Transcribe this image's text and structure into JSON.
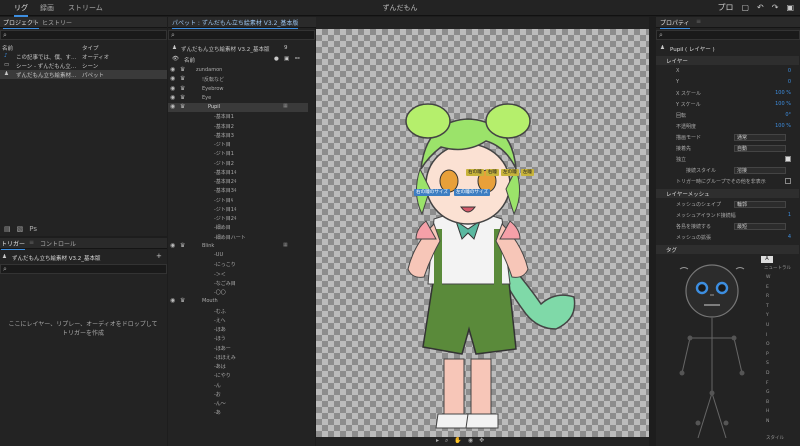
{
  "app": {
    "window_title": "ずんだもん",
    "tabs": [
      "リグ",
      "録画",
      "ストリーム"
    ],
    "user_label": "プロ"
  },
  "project_panel": {
    "tabs": [
      "プロジェクト",
      "ヒストリー"
    ],
    "col_name": "名前",
    "col_type": "タイプ",
    "items": [
      {
        "name": "この記事では、僕、す…",
        "type": "オーディオ"
      },
      {
        "name": "シーン - ずんだもん立…",
        "type": "シーン"
      },
      {
        "name": "ずんだもん立ち絵素材…",
        "type": "パペット"
      }
    ]
  },
  "trigger_panel": {
    "tabs": [
      "トリガー",
      "コントロール"
    ],
    "puppet": "ずんだもん立ち絵素材 V3.2_基本版",
    "empty_message": "ここにレイヤー、リプレー、オーディオをドロップしてトリガーを作成"
  },
  "puppet_panel": {
    "header": "パペット : ずんだもん立ち絵素材 V3.2_基本版",
    "title": "ずんだもん立ち絵素材 V3.2_基本版",
    "count": "9",
    "col_name": "名前",
    "layers": [
      "zundamon",
      "!反転など",
      "Eyebrow",
      "Eye",
      "Pupil",
      "-基本目1",
      "-基本目2",
      "-基本目3",
      "-ジト目",
      "-ジト目1",
      "-ジト目2",
      "-基本目1ｷ",
      "-基本目2ｷ",
      "-基本目3ｷ",
      "-ジト目ｷ",
      "-ジト目1ｷ",
      "-ジト目2ｷ",
      "-細め目",
      "-細め目ハート",
      "Blink",
      "-UU",
      "-にっこり",
      "-＞＜",
      "-なごみ目",
      "-〇〇",
      "Mouth",
      "-むふ",
      "-えへ",
      "-ほあ",
      "-ほう",
      "-ほあー",
      "-ほほえみ",
      "-あは",
      "-にやり",
      "-ん",
      "-お",
      "-ん～",
      "-あ"
    ]
  },
  "canvas": {
    "handles": [
      "右の瞳",
      "右瞳",
      "左の瞳",
      "左瞳"
    ],
    "size_handles": [
      "右の瞳のサイズ",
      "左の瞳のサイズ"
    ]
  },
  "properties": {
    "title": "プロパティ",
    "layer_name": "Pupil ( レイヤー )",
    "layer_section": "レイヤー",
    "rows": [
      {
        "k": "X",
        "v": "0"
      },
      {
        "k": "Y",
        "v": "0"
      },
      {
        "k": "X スケール",
        "v": "100 %"
      },
      {
        "k": "Y スケール",
        "v": "100 %"
      },
      {
        "k": "回転",
        "v": "0°"
      },
      {
        "k": "不透明度",
        "v": "100 %"
      }
    ],
    "blend_label": "描画モード",
    "blend_value": "通常",
    "attach_label": "接着先",
    "attach_value": "自動",
    "independent_label": "独立",
    "joint_label": "接続スタイル",
    "joint_value": "溶接",
    "trigger_label": "トリガー時にグループでその他を非表示",
    "mesh_section": "レイヤーメッシュ",
    "mesh_shape_label": "メッシュのシェイプ",
    "mesh_shape_value": "輪郭",
    "mesh_density_label": "メッシュアイランド接続幅",
    "mesh_density_value": "1",
    "mesh_connect_label": "各島を接続する",
    "mesh_connect_value": "最短",
    "mesh_expand_label": "メッシュの拡張",
    "mesh_expand_value": "4",
    "tag_section": "タグ",
    "neutral_label": "ニュートラル",
    "tag_labels": [
      "W",
      "E",
      "R",
      "T",
      "Y",
      "U",
      "I",
      "O",
      "P",
      "S",
      "D",
      "F",
      "G",
      "B",
      "H",
      "N"
    ],
    "tag_tail": "スタイル"
  },
  "colors": {
    "accent": "#3d8ee0",
    "bg": "#1d1d1d",
    "panel": "#232323"
  }
}
